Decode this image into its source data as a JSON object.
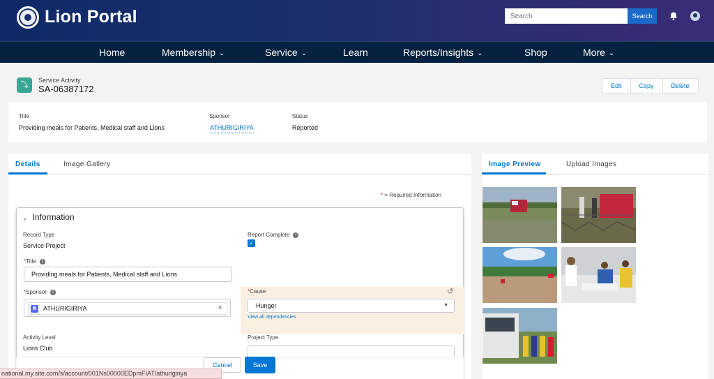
{
  "header": {
    "brand": "Lion Portal",
    "search": {
      "placeholder": "Search",
      "button": "Search"
    }
  },
  "nav": [
    {
      "label": "Home",
      "has_menu": false
    },
    {
      "label": "Membership",
      "has_menu": true
    },
    {
      "label": "Service",
      "has_menu": true
    },
    {
      "label": "Learn",
      "has_menu": false
    },
    {
      "label": "Reports/Insights",
      "has_menu": true
    },
    {
      "label": "Shop",
      "has_menu": false
    },
    {
      "label": "More",
      "has_menu": true
    }
  ],
  "record": {
    "object_type": "Service Activity",
    "name": "SA-06387172",
    "actions": {
      "edit": "Edit",
      "copy": "Copy",
      "delete": "Delete"
    }
  },
  "highlights": {
    "title_label": "Title",
    "title_value": "Providing meals for Patients, Medical staff and Lions",
    "sponsor_label": "Sponsor",
    "sponsor_value": "ATHURIGIRIYA",
    "status_label": "Status",
    "status_value": "Reported"
  },
  "left_tabs": {
    "details": "Details",
    "gallery": "Image Gallery"
  },
  "form": {
    "required_star": "*",
    "required_note": "= Required Information",
    "section_title": "Information",
    "record_type_label": "Record Type",
    "record_type_value": "Service Project",
    "report_complete_label": "Report Complete",
    "report_complete_checked": true,
    "title_label": "Title",
    "title_value": "Providing meals for Patients, Medical staff and Lions",
    "sponsor_label": "Sponsor",
    "sponsor_value": "ATHURIGIRIYA",
    "cause_label": "Cause",
    "cause_value": "Hunger",
    "view_dependencies": "View all dependencies",
    "activity_level_label": "Activity Level",
    "activity_level_value": "Lions Club",
    "project_type_label": "Project Type"
  },
  "footer": {
    "cancel": "Cancel",
    "save": "Save"
  },
  "right_tabs": {
    "preview": "Image Preview",
    "upload": "Upload Images"
  },
  "photos": [
    {
      "name": "photo-red-vehicle-field",
      "sky": "#9fb4c6",
      "ground": "#7a8a5a",
      "accent": "#b4243a"
    },
    {
      "name": "photo-people-loading-truck",
      "sky": "#8c8a6e",
      "ground": "#6a6a4a",
      "accent": "#c2263c"
    },
    {
      "name": "photo-road-landscape",
      "sky": "#5f9fd8",
      "ground": "#b99a7a",
      "accent": "#3f7a3a"
    },
    {
      "name": "photo-meal-distribution",
      "sky": "#cfd2d4",
      "ground": "#e7e7e7",
      "accent": "#2f5faf"
    },
    {
      "name": "photo-group-by-bus",
      "sky": "#8fb0c9",
      "ground": "#6f8a4f",
      "accent": "#e9c230"
    }
  ],
  "status_url": "national.my.site.com/s/account/001Ns00000EDpmFIAT/athurigiriya",
  "colors": {
    "brand_blue": "#0176d3",
    "nav_dark": "#04223f",
    "header": "#1c2f6e",
    "cause_highlight": "#faf0e1"
  }
}
